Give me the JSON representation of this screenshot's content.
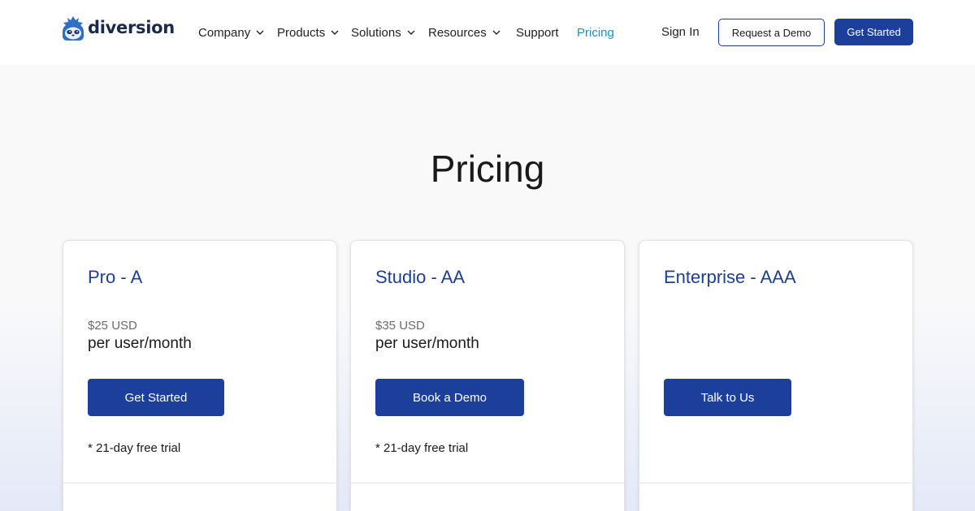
{
  "brand": {
    "name": "diversion",
    "logo_icon": "sloth-logo-icon",
    "primary_color": "#1b3f9a",
    "accent_color": "#1d8fcb"
  },
  "nav": {
    "items": [
      {
        "label": "Company",
        "has_dropdown": true
      },
      {
        "label": "Products",
        "has_dropdown": true
      },
      {
        "label": "Solutions",
        "has_dropdown": true
      },
      {
        "label": "Resources",
        "has_dropdown": true
      },
      {
        "label": "Support",
        "has_dropdown": false
      },
      {
        "label": "Pricing",
        "has_dropdown": false,
        "active": true
      }
    ],
    "sign_in": "Sign In",
    "request_demo": "Request a Demo",
    "get_started": "Get Started"
  },
  "page": {
    "title": "Pricing"
  },
  "plans": [
    {
      "name": "Pro - A",
      "price": "$25 USD",
      "unit": "per user/month",
      "cta": "Get Started",
      "note": "* 21-day free trial"
    },
    {
      "name": "Studio - AA",
      "price": "$35 USD",
      "unit": "per user/month",
      "cta": "Book a Demo",
      "note": "* 21-day free trial"
    },
    {
      "name": "Enterprise - AAA",
      "price": "",
      "unit": "",
      "cta": "Talk to Us",
      "note": ""
    }
  ]
}
